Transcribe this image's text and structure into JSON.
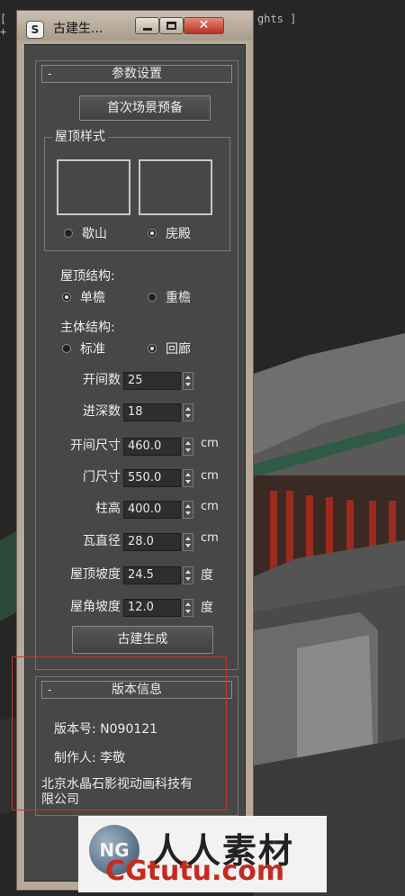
{
  "viewport": {
    "label": "ghts ]",
    "left_label": "[ +"
  },
  "window": {
    "title": "古建生...",
    "app_icon": "3ds-max-icon",
    "buttons": {
      "minimize": "minimize-icon",
      "maximize": "maximize-icon",
      "close": "close-icon",
      "close_glyph": "✕"
    }
  },
  "params": {
    "header": "参数设置",
    "collapse": "-",
    "preview_button": "首次场景预备",
    "roof_style": {
      "caption": "屋顶样式",
      "options": [
        {
          "label": "歇山",
          "selected": false
        },
        {
          "label": "庑殿",
          "selected": true
        }
      ]
    },
    "roof_structure": {
      "label": "屋顶结构:",
      "options": [
        {
          "label": "单檐",
          "selected": true
        },
        {
          "label": "重檐",
          "selected": false
        }
      ]
    },
    "main_structure": {
      "label": "主体结构:",
      "options": [
        {
          "label": "标准",
          "selected": false
        },
        {
          "label": "回廊",
          "selected": true
        }
      ]
    },
    "fields": [
      {
        "label": "开间数",
        "value": "25",
        "unit": ""
      },
      {
        "label": "进深数",
        "value": "18",
        "unit": ""
      },
      {
        "label": "开间尺寸",
        "value": "460.0",
        "unit": "cm"
      },
      {
        "label": "门尺寸",
        "value": "550.0",
        "unit": "cm"
      },
      {
        "label": "柱高",
        "value": "400.0",
        "unit": "cm"
      },
      {
        "label": "瓦直径",
        "value": "28.0",
        "unit": "cm"
      },
      {
        "label": "屋顶坡度",
        "value": "24.5",
        "unit": "度"
      },
      {
        "label": "屋角坡度",
        "value": "12.0",
        "unit": "度"
      }
    ],
    "generate_button": "古建生成"
  },
  "version": {
    "header": "版本信息",
    "collapse": "-",
    "version_line": "版本号: N090121",
    "author_line": "制作人: 李敬",
    "company_line1": "北京水晶石影视动画科技有",
    "company_line2": "限公司"
  },
  "banner": {
    "logo_text": "NG",
    "cn_text": "人人素材",
    "url_text": "CGtutu.com"
  },
  "colors": {
    "highlight": "#c0392b",
    "panel": "#474747",
    "url": "#c62a1f"
  }
}
